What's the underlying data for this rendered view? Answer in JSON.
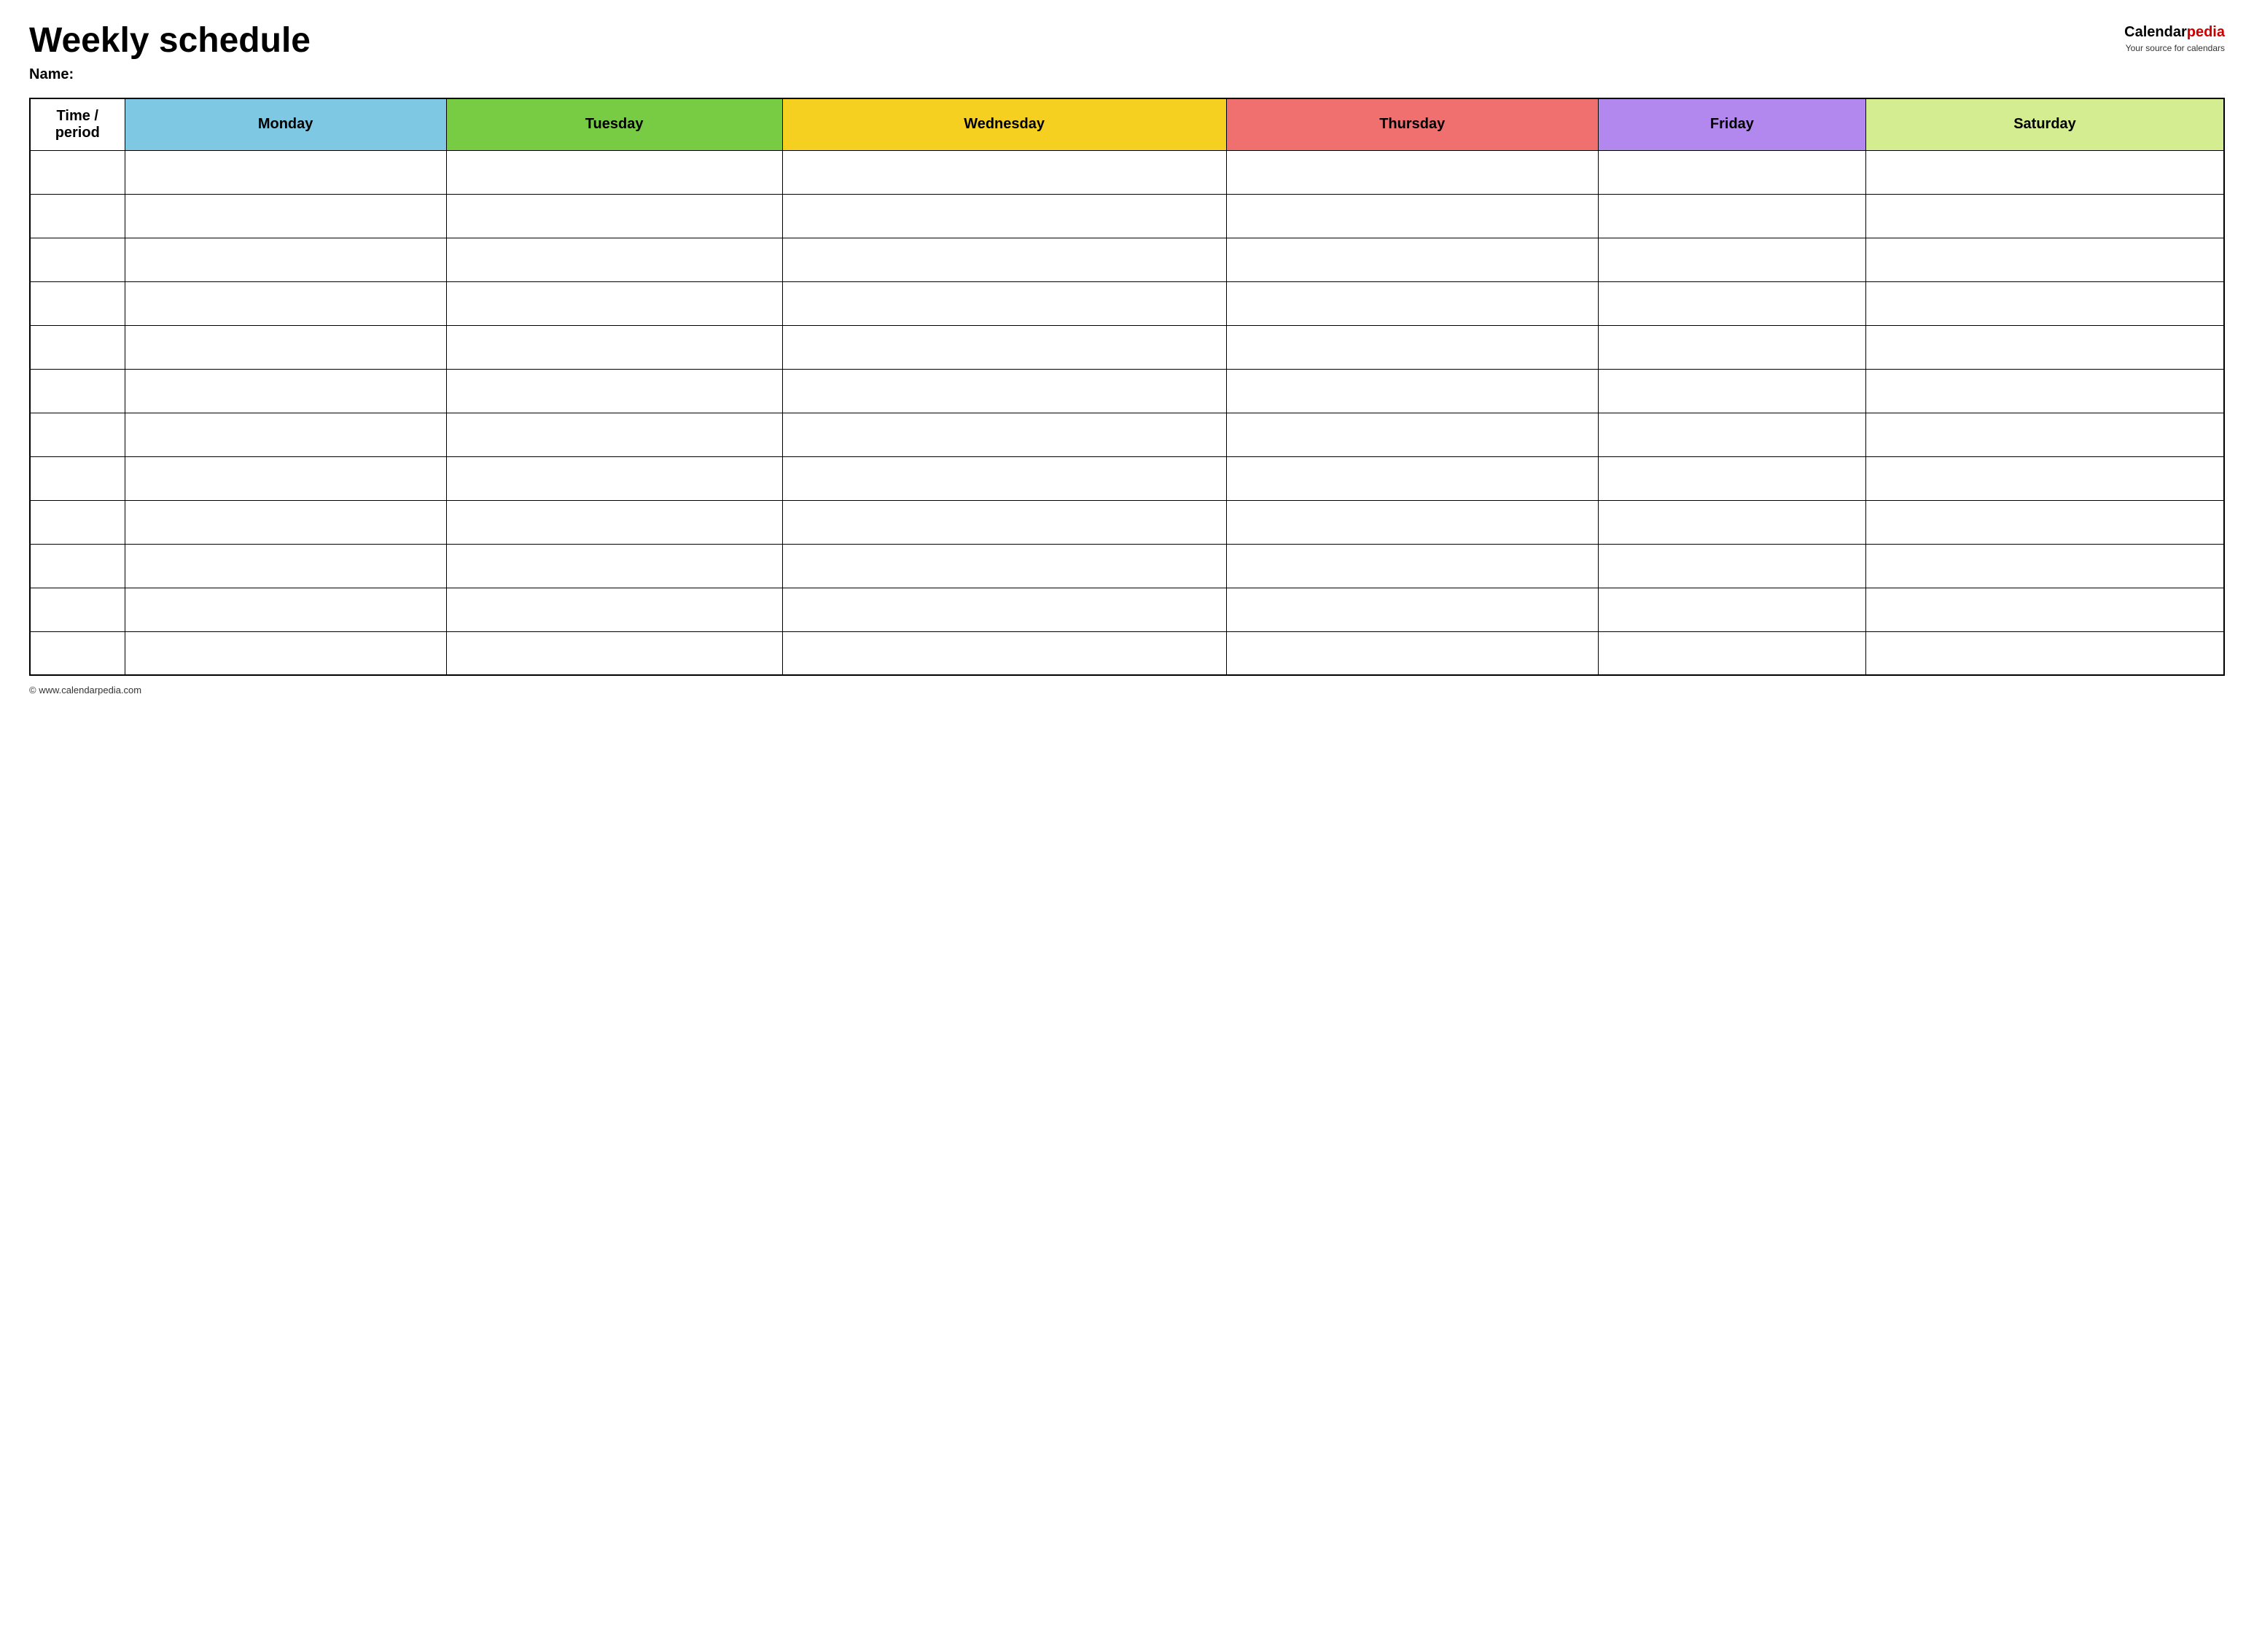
{
  "header": {
    "title": "Weekly schedule",
    "name_label": "Name:",
    "logo": {
      "brand_part1": "Calendar",
      "brand_part2": "pedia",
      "tagline": "Your source for calendars"
    }
  },
  "table": {
    "columns": [
      {
        "id": "time",
        "label": "Time / period",
        "color": "#ffffff",
        "class": "th-time"
      },
      {
        "id": "monday",
        "label": "Monday",
        "color": "#7ec8e3",
        "class": "th-monday"
      },
      {
        "id": "tuesday",
        "label": "Tuesday",
        "color": "#77cc44",
        "class": "th-tuesday"
      },
      {
        "id": "wednesday",
        "label": "Wednesday",
        "color": "#f5d020",
        "class": "th-wednesday"
      },
      {
        "id": "thursday",
        "label": "Thursday",
        "color": "#f07070",
        "class": "th-thursday"
      },
      {
        "id": "friday",
        "label": "Friday",
        "color": "#b388ee",
        "class": "th-friday"
      },
      {
        "id": "saturday",
        "label": "Saturday",
        "color": "#d4ed91",
        "class": "th-saturday"
      }
    ],
    "row_count": 12
  },
  "footer": {
    "url": "© www.calendarpedia.com"
  }
}
